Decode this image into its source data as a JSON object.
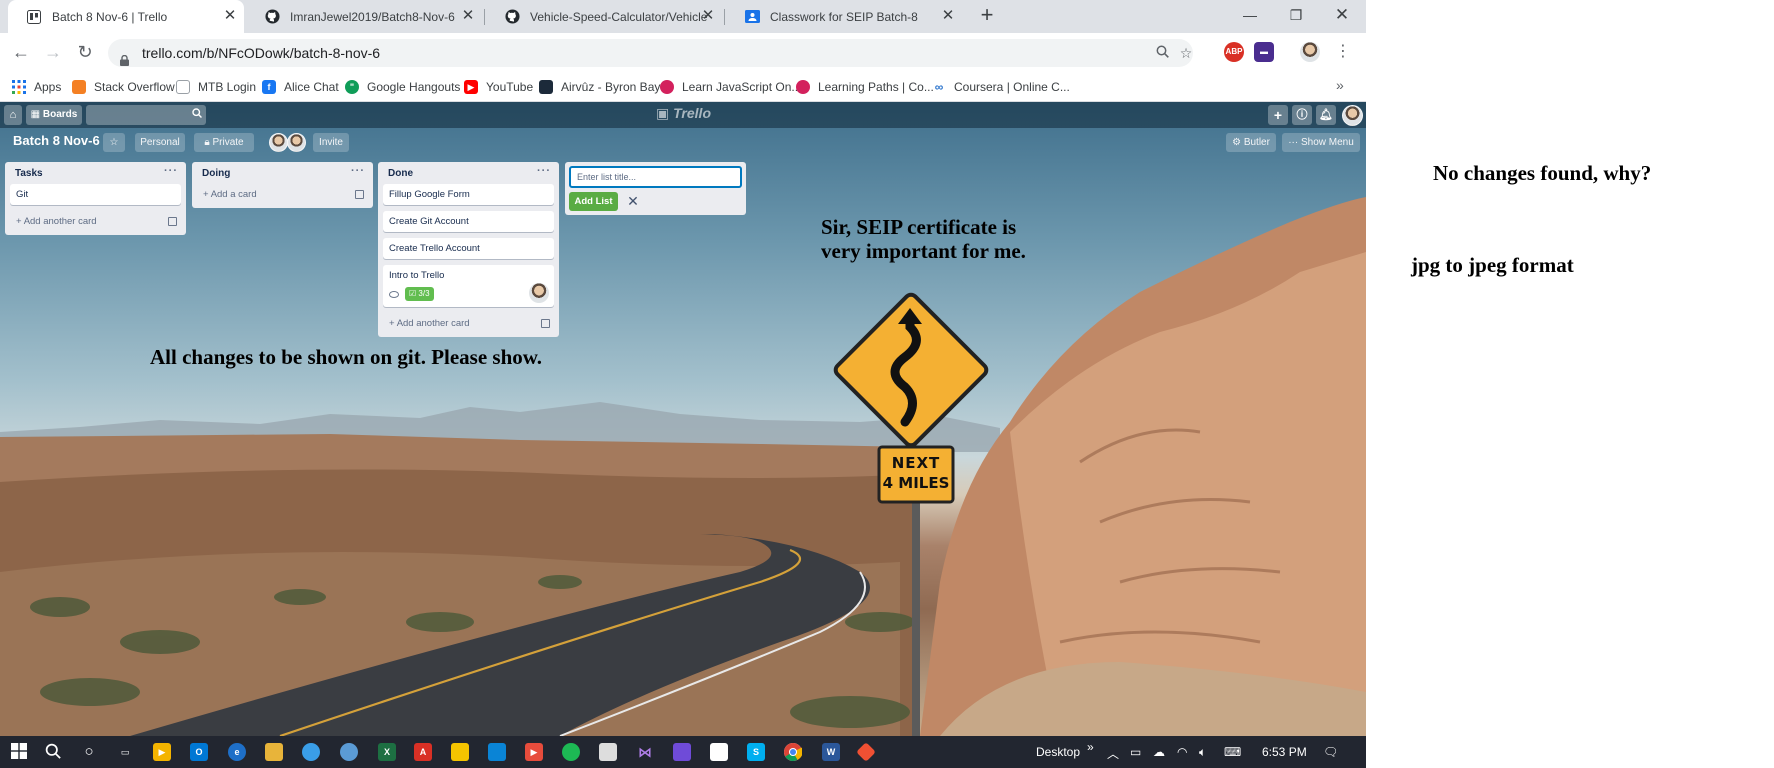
{
  "browser": {
    "tabs": [
      {
        "title": "Batch 8 Nov-6 | Trello",
        "active": true,
        "icon": "trello-icon"
      },
      {
        "title": "ImranJewel2019/Batch8-Nov-6",
        "active": false,
        "icon": "github-icon"
      },
      {
        "title": "Vehicle-Speed-Calculator/Vehicle",
        "active": false,
        "icon": "github-icon"
      },
      {
        "title": "Classwork for SEIP Batch-8",
        "active": false,
        "icon": "google-classroom-icon"
      }
    ],
    "url": "trello.com/b/NFcODowk/batch-8-nov-6",
    "extensions": {
      "abp": "ABP"
    }
  },
  "bookmarks": [
    {
      "label": "Apps",
      "icon": "apps-grid-icon",
      "color": "#ea4335"
    },
    {
      "label": "Stack Overflow",
      "icon": "stackoverflow-icon",
      "color": "#f48024"
    },
    {
      "label": "MTB Login",
      "icon": "page-icon",
      "color": "#9aa0a6"
    },
    {
      "label": "Alice Chat",
      "icon": "facebook-icon",
      "color": "#1877f2"
    },
    {
      "label": "Google Hangouts",
      "icon": "hangouts-icon",
      "color": "#0f9d58"
    },
    {
      "label": "YouTube",
      "icon": "youtube-icon",
      "color": "#ff0000"
    },
    {
      "label": "Airvûz - Byron Bay",
      "icon": "airvuz-icon",
      "color": "#1c2a3a"
    },
    {
      "label": "Learn JavaScript On...",
      "icon": "scrimba-icon",
      "color": "#d3215d"
    },
    {
      "label": "Learning Paths | Co...",
      "icon": "scrimba-icon",
      "color": "#d3215d"
    },
    {
      "label": "Coursera | Online C...",
      "icon": "coursera-icon",
      "color": "#2a73cc"
    }
  ],
  "trello": {
    "header": {
      "boards_label": "Boards",
      "logo": "Trello"
    },
    "board": {
      "title": "Batch 8 Nov-6",
      "team": "Personal",
      "visibility": "Private",
      "invite": "Invite",
      "butler": "Butler",
      "show_menu": "Show Menu"
    },
    "lists": [
      {
        "name": "Tasks",
        "cards": [
          {
            "title": "Git"
          }
        ],
        "add_card": "Add another card"
      },
      {
        "name": "Doing",
        "cards": [],
        "add_card": "Add a card"
      },
      {
        "name": "Done",
        "cards": [
          {
            "title": "Fillup Google Form"
          },
          {
            "title": "Create Git Account"
          },
          {
            "title": "Create Trello Account"
          },
          {
            "title": "Intro to Trello",
            "checklist": "3/3"
          }
        ],
        "add_card": "Add another card"
      }
    ],
    "add_list": {
      "placeholder": "Enter list title...",
      "button": "Add List"
    }
  },
  "road_sign": {
    "line1": "NEXT",
    "line2": "4 MILES"
  },
  "annotations": {
    "main": "All changes to be shown on git. Please show.",
    "certificate_line1": "Sir, SEIP certificate is",
    "certificate_line2": "very important for me.",
    "no_changes": "No changes found, why?",
    "jpg": "jpg to jpeg format"
  },
  "taskbar": {
    "desktop": "Desktop",
    "time": "6:53 PM"
  },
  "colors": {
    "trello_green": "#5aac44",
    "trello_blue": "#0079bf",
    "list_bg": "#ebecf0"
  }
}
